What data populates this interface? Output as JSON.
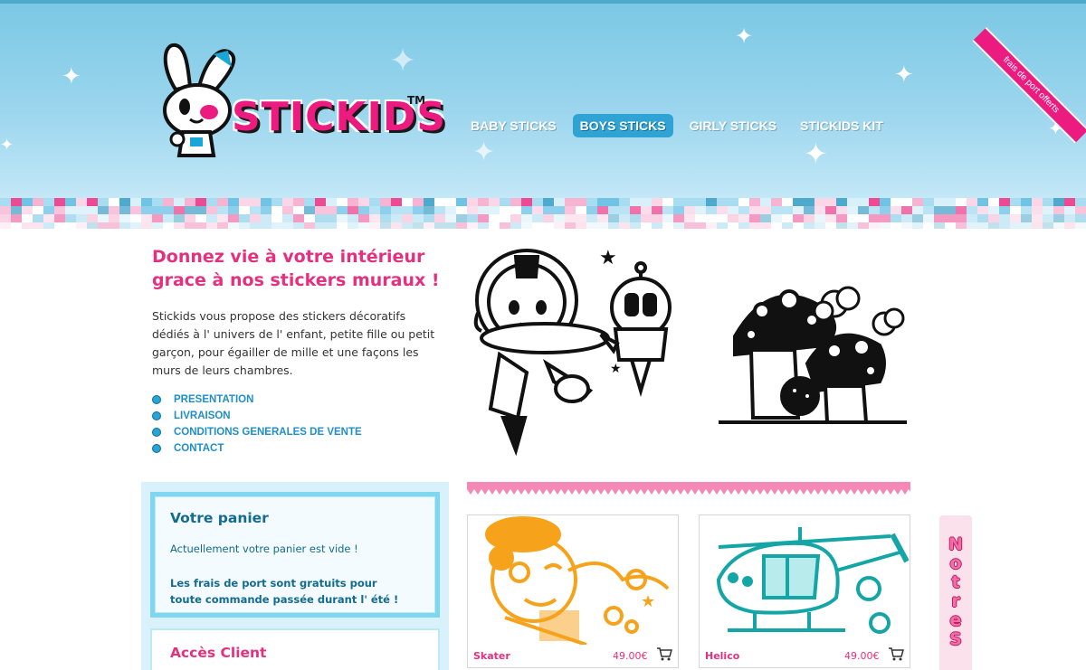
{
  "brand": {
    "name": "STICKIDS",
    "tm": "TM"
  },
  "nav": [
    {
      "label": "BABY STICKS",
      "active": false
    },
    {
      "label": "BOYS STICKS",
      "active": true
    },
    {
      "label": "GIRLY STICKS",
      "active": false
    },
    {
      "label": "STICKIDS KIT",
      "active": false
    }
  ],
  "ribbon": "frais de port offerts",
  "intro": {
    "title": "Donnez vie à votre intérieur grace à nos stickers muraux !",
    "text": "Stickids vous propose des stickers décoratifs dédiés à l' univers de l' enfant, petite fille ou petit garçon, pour égailler de mille et une façons les murs de leurs chambres.",
    "links": [
      "PRESENTATION",
      "LIVRAISON",
      "CONDITIONS GENERALES DE VENTE",
      "CONTACT"
    ]
  },
  "cart": {
    "title": "Votre panier",
    "empty": "Actuellement votre panier est vide !",
    "note": "Les frais de port sont gratuits pour toute commande passée durant l' été !"
  },
  "client": {
    "title": "Accès Client"
  },
  "products": [
    {
      "name": "Skater",
      "price": "49.00€",
      "color": "#f7a21b"
    },
    {
      "name": "Helico",
      "price": "49.00€",
      "color": "#14a6a6"
    }
  ],
  "side_tab": "Notre\nS",
  "colors": {
    "pink": "#e4317f",
    "blue": "#1e8fc8",
    "sky": "#7bc8e4"
  }
}
